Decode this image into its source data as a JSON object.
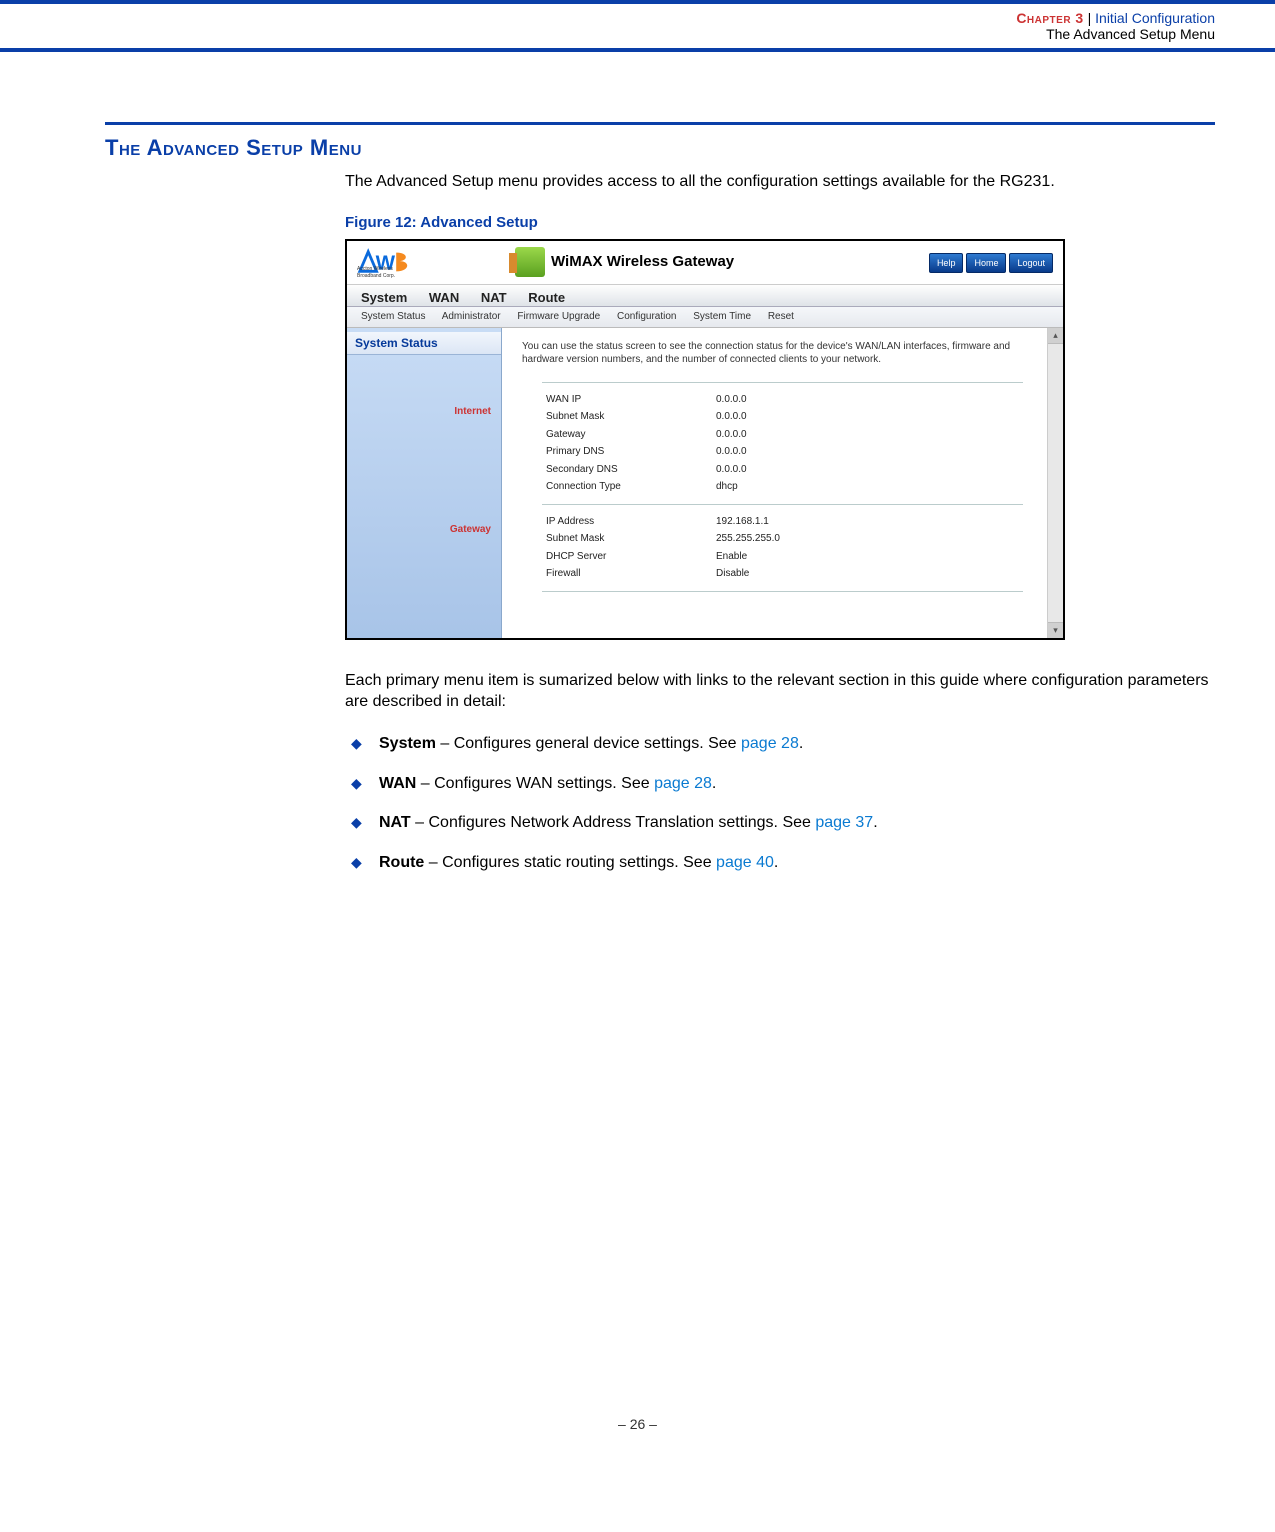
{
  "header": {
    "chapter_label": "Chapter 3",
    "chapter_title": "Initial Configuration",
    "sub": "The Advanced Setup Menu"
  },
  "section": {
    "title": "The Advanced Setup Menu",
    "intro": "The Advanced Setup menu provides access to all the configuration settings available for the RG231.",
    "figure_caption": "Figure 12:  Advanced Setup",
    "after_fig": "Each primary menu item is sumarized below with links to the relevant section in this guide where configuration parameters are described in detail:"
  },
  "screenshot": {
    "logo_sub": "Accton Wireless Broadband Corp.",
    "banner_title": "WiMAX Wireless Gateway",
    "top_buttons": [
      "Help",
      "Home",
      "Logout"
    ],
    "tabs": [
      "System",
      "WAN",
      "NAT",
      "Route"
    ],
    "subtabs": [
      "System Status",
      "Administrator",
      "Firmware Upgrade",
      "Configuration",
      "System Time",
      "Reset"
    ],
    "side_header": "System Status",
    "side_labels": [
      "Internet",
      "Gateway"
    ],
    "intro_text": "You can use the status screen to see the connection status for the device's WAN/LAN interfaces, firmware and hardware version numbers, and the number of connected clients to your network.",
    "internet_rows": [
      {
        "k": "WAN IP",
        "v": "0.0.0.0"
      },
      {
        "k": "Subnet Mask",
        "v": "0.0.0.0"
      },
      {
        "k": "Gateway",
        "v": "0.0.0.0"
      },
      {
        "k": "Primary DNS",
        "v": "0.0.0.0"
      },
      {
        "k": "Secondary DNS",
        "v": "0.0.0.0"
      },
      {
        "k": "Connection Type",
        "v": "dhcp"
      }
    ],
    "gateway_rows": [
      {
        "k": "IP Address",
        "v": "192.168.1.1"
      },
      {
        "k": "Subnet Mask",
        "v": "255.255.255.0"
      },
      {
        "k": "DHCP Server",
        "v": "Enable"
      },
      {
        "k": "Firewall",
        "v": "Disable"
      }
    ]
  },
  "bullets": [
    {
      "bold": "System",
      "text": " – Configures general device settings. See ",
      "link": "page 28",
      "tail": "."
    },
    {
      "bold": "WAN",
      "text": " – Configures WAN settings. See ",
      "link": "page 28",
      "tail": "."
    },
    {
      "bold": "NAT",
      "text": " – Configures Network Address Translation settings. See ",
      "link": "page 37",
      "tail": "."
    },
    {
      "bold": "Route",
      "text": " – Configures static routing settings. See ",
      "link": "page 40",
      "tail": "."
    }
  ],
  "footer": "–  26  –"
}
